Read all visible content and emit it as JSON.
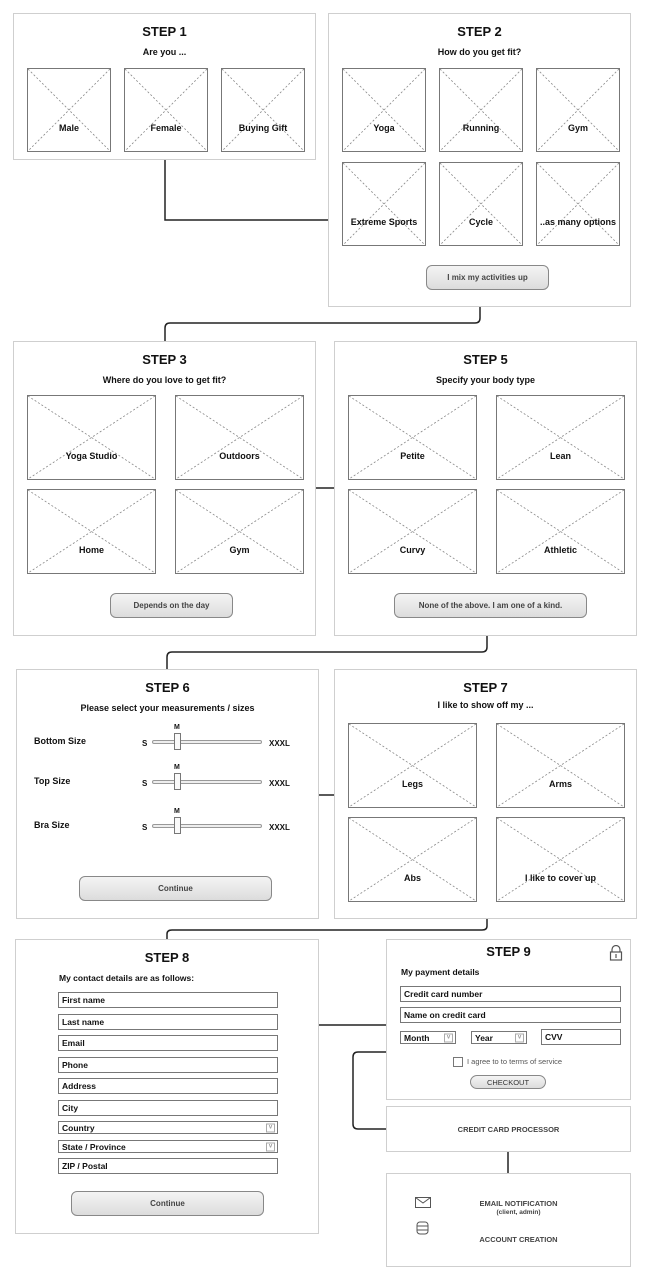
{
  "step1": {
    "title": "STEP 1",
    "subtitle": "Are you ...",
    "options": [
      "Male",
      "Female",
      "Buying Gift"
    ]
  },
  "step2": {
    "title": "STEP 2",
    "subtitle": "How do you get fit?",
    "options": [
      "Yoga",
      "Running",
      "Gym",
      "Extreme Sports",
      "Cycle",
      "..as many options"
    ],
    "button": "I mix my activities up"
  },
  "step3": {
    "title": "STEP 3",
    "subtitle": "Where do you love to get fit?",
    "options": [
      "Yoga Studio",
      "Outdoors",
      "Home",
      "Gym"
    ],
    "button": "Depends on the day"
  },
  "step5": {
    "title": "STEP 5",
    "subtitle": "Specify your body type",
    "options": [
      "Petite",
      "Lean",
      "Curvy",
      "Athletic"
    ],
    "button": "None of the above. I am one of a kind."
  },
  "step6": {
    "title": "STEP 6",
    "subtitle": "Please select your measurements / sizes",
    "sliders": [
      {
        "label": "Bottom Size",
        "min": "S",
        "max": "XXXL",
        "value": "M"
      },
      {
        "label": "Top Size",
        "min": "S",
        "max": "XXXL",
        "value": "M"
      },
      {
        "label": "Bra Size",
        "min": "S",
        "max": "XXXL",
        "value": "M"
      }
    ],
    "button": "Continue"
  },
  "step7": {
    "title": "STEP 7",
    "subtitle": "I like to show off my ...",
    "options": [
      "Legs",
      "Arms",
      "Abs",
      "I like to cover up"
    ]
  },
  "step8": {
    "title": "STEP 8",
    "subtitle": "My contact details are as follows:",
    "fields": [
      {
        "label": "First name",
        "type": "text"
      },
      {
        "label": "Last name",
        "type": "text"
      },
      {
        "label": "Email",
        "type": "text"
      },
      {
        "label": "Phone",
        "type": "text"
      },
      {
        "label": "Address",
        "type": "text"
      },
      {
        "label": "City",
        "type": "text"
      },
      {
        "label": "Country",
        "type": "select"
      },
      {
        "label": "State / Province",
        "type": "select"
      },
      {
        "label": "ZIP / Postal",
        "type": "text"
      }
    ],
    "button": "Continue"
  },
  "step9": {
    "title": "STEP 9",
    "subtitle": "My payment details",
    "icon": "lock-icon",
    "card_number": "Credit card number",
    "card_name": "Name on credit card",
    "month": "Month",
    "year": "Year",
    "cvv": "CVV",
    "terms": "I agree to to terms of service",
    "terms_checked": false,
    "button": "CHECKOUT"
  },
  "processor": {
    "label": "CREDIT CARD PROCESSOR"
  },
  "notifications": {
    "email": "EMAIL NOTIFICATION",
    "email_sub": "(client, admin)",
    "email_icon": "envelope-icon",
    "account": "ACCOUNT CREATION",
    "account_icon": "database-icon"
  }
}
